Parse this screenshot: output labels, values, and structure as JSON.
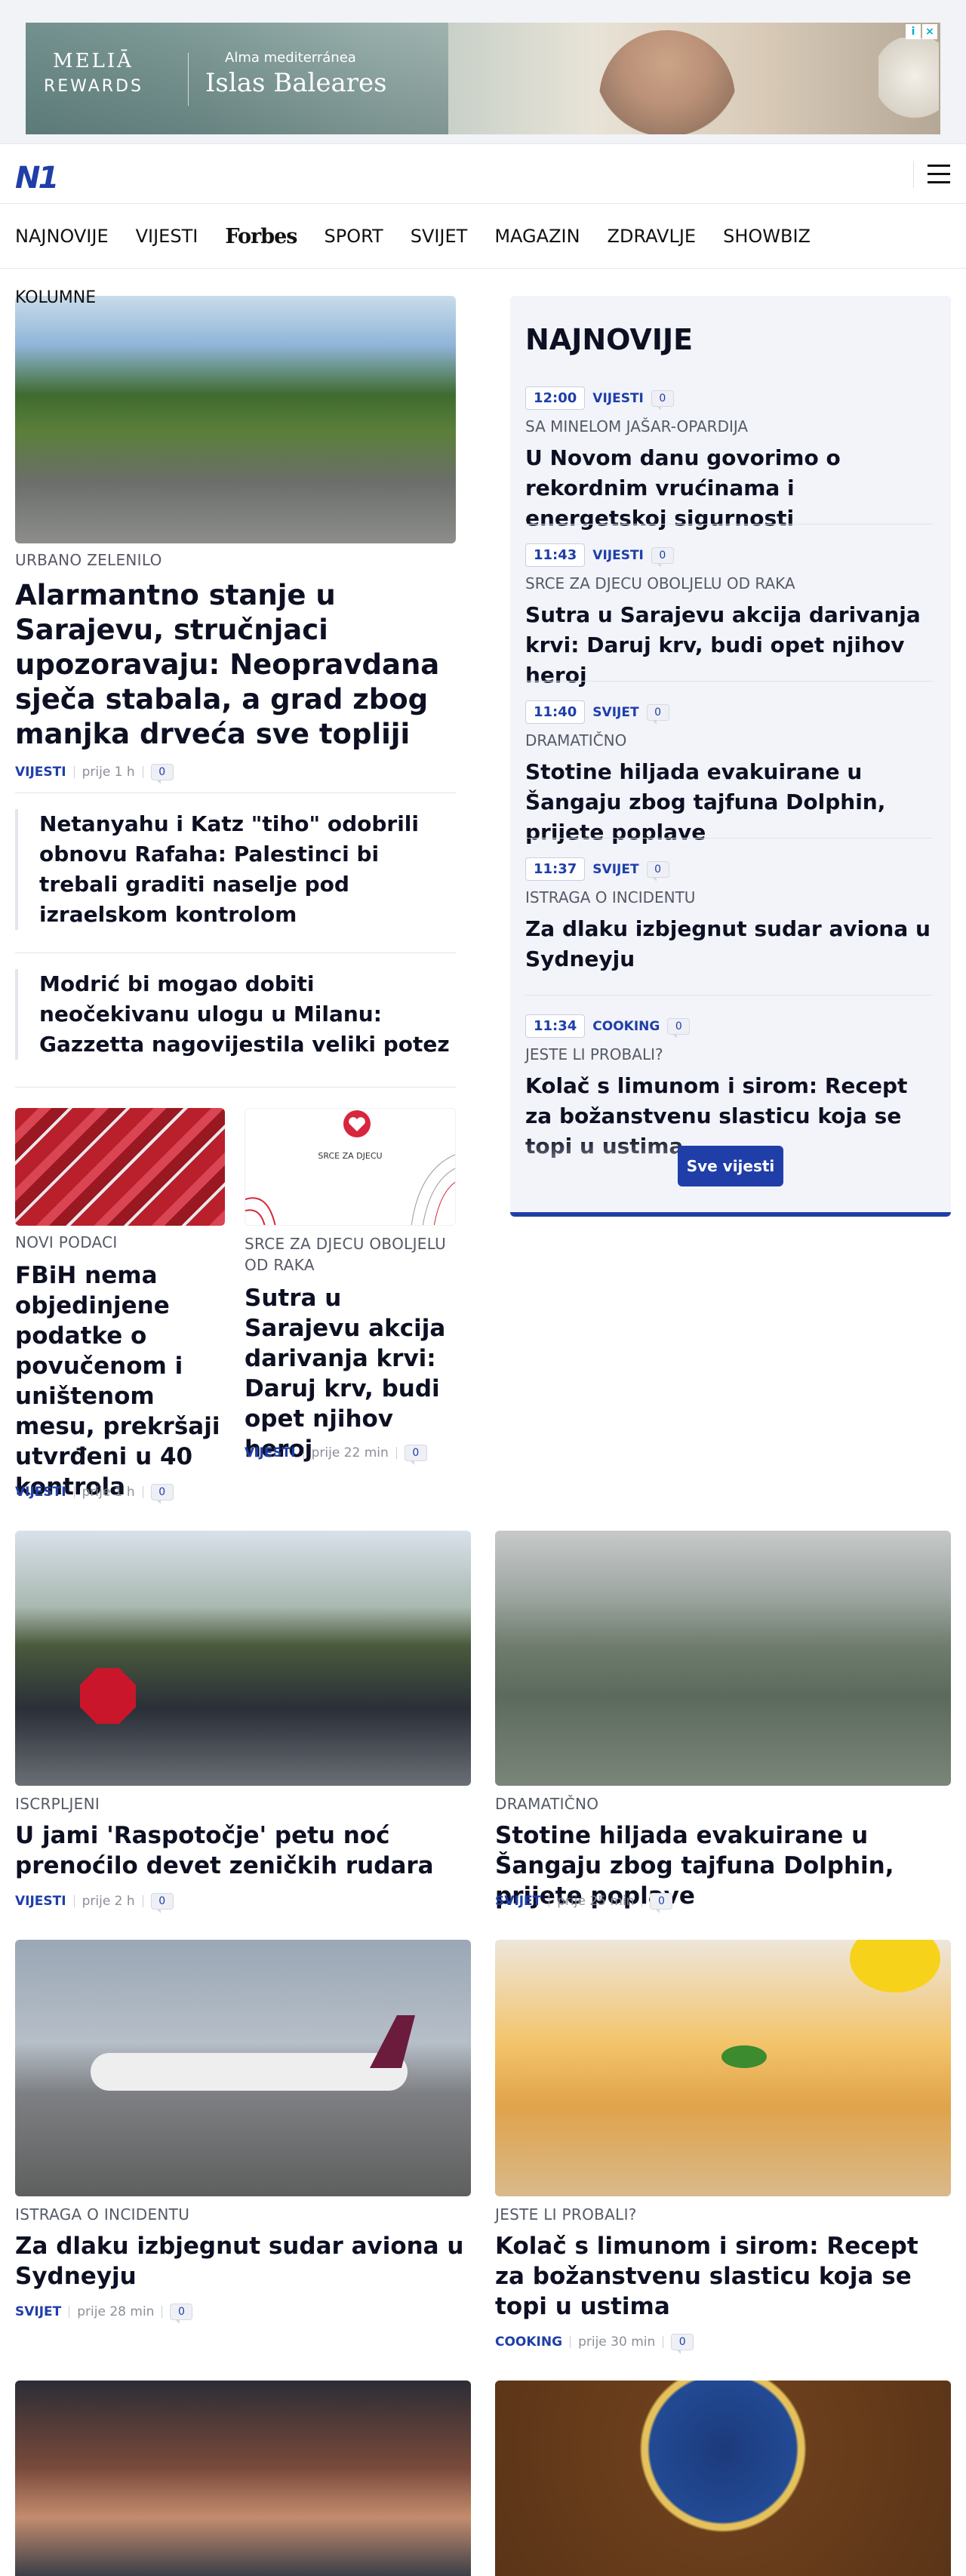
{
  "ad": {
    "brand_top": "MELIĀ",
    "brand_bottom": "REWARDS",
    "subtitle": "Alma mediterránea",
    "headline": "Islas Baleares"
  },
  "header": {
    "logo": "N1"
  },
  "nav": {
    "items": [
      "NAJNOVIJE",
      "VIJESTI",
      "Forbes",
      "SPORT",
      "SVIJET",
      "MAGAZIN",
      "ZDRAVLJE",
      "SHOWBIZ"
    ],
    "subitem": "KOLUMNE"
  },
  "main": {
    "lead": {
      "kicker": "URBANO ZELENILO",
      "title": "Alarmantno stanje u Sarajevu, stručnjaci upozoravaju: Neopravdana sječa stabala, a grad zbog manjka drveća sve topliji",
      "category": "VIJESTI",
      "time": "prije 1 h",
      "comments": "0"
    },
    "side_links": [
      "Netanyahu i Katz \"tiho\" odobrili obnovu Rafaha: Palestinci bi trebali graditi naselje pod izraelskom kontrolom",
      "Modrić bi mogao dobiti neočekivanu ulogu u Milanu: Gazzetta nagovijestila veliki potez"
    ],
    "small_cards": [
      {
        "kicker": "NOVI PODACI",
        "title": "FBiH nema objedinjene podatke o povučenom i uništenom mesu, prekršaji utvrđeni u 40 kontrola",
        "category": "VIJESTI",
        "time": "prije 1 h",
        "comments": "0"
      },
      {
        "kicker": "SRCE ZA DJECU OBOLJELU OD RAKA",
        "title": "Sutra u Sarajevu akcija darivanja krvi: Daruj krv, budi opet njihov heroj",
        "category": "VIJESTI",
        "time": "prije 22 min",
        "comments": "0",
        "logo_text": "SRCE ZA DJECU"
      }
    ],
    "grid": [
      {
        "kicker": "ISCRPLJENI",
        "title": "U jami 'Raspotočje' petu noć prenoćilo devet zeničkih rudara",
        "category": "VIJESTI",
        "time": "prije 2 h",
        "comments": "0"
      },
      {
        "kicker": "DRAMATIČNO",
        "title": "Stotine hiljada evakuirane u Šangaju zbog tajfuna Dolphin, prijete poplave",
        "category": "SVIJET",
        "time": "prije 25 min",
        "comments": "0"
      },
      {
        "kicker": "ISTRAGA O INCIDENTU",
        "title": "Za dlaku izbjegnut sudar aviona u Sydneyju",
        "category": "SVIJET",
        "time": "prije 28 min",
        "comments": "0"
      },
      {
        "kicker": "JESTE LI PROBALI?",
        "title": "Kolač s limunom i sirom: Recept za božanstvenu slasticu koja se topi u ustima",
        "category": "COOKING",
        "time": "prije 30 min",
        "comments": "0"
      }
    ]
  },
  "latest": {
    "heading": "NAJNOVIJE",
    "items": [
      {
        "time": "12:00",
        "category": "VIJESTI",
        "comments": "0",
        "kicker": "SA MINELOM JAŠAR-OPARDIJA",
        "title": "U Novom danu govorimo o rekordnim vrućinama i energetskoj sigurnosti"
      },
      {
        "time": "11:43",
        "category": "VIJESTI",
        "comments": "0",
        "kicker": "SRCE ZA DJECU OBOLJELU OD RAKA",
        "title": "Sutra u Sarajevu akcija darivanja krvi: Daruj krv, budi opet njihov heroj"
      },
      {
        "time": "11:40",
        "category": "SVIJET",
        "comments": "0",
        "kicker": "DRAMATIČNO",
        "title": "Stotine hiljada evakuirane u Šangaju zbog tajfuna Dolphin, prijete poplave"
      },
      {
        "time": "11:37",
        "category": "SVIJET",
        "comments": "0",
        "kicker": "ISTRAGA O INCIDENTU",
        "title": "Za dlaku izbjegnut sudar aviona u Sydneyju"
      },
      {
        "time": "11:34",
        "category": "COOKING",
        "comments": "0",
        "kicker": "JESTE LI PROBALI?",
        "title": "Kolač s limunom i sirom: Recept za božanstvenu slasticu koja se topi u ustima"
      }
    ],
    "more_label": "Sve vijesti"
  },
  "colors": {
    "brand": "#1f3ea8",
    "panel_bg": "#f2f4fa"
  }
}
